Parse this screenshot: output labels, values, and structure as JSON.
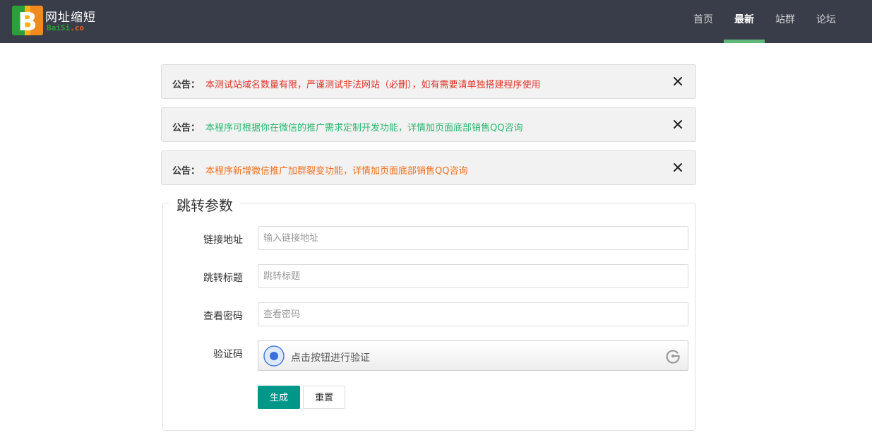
{
  "header": {
    "logo_letter": "B",
    "site_title": "网址缩短",
    "site_sub_green": "BaiSi",
    "site_sub_orange": ".co",
    "nav": [
      {
        "label": "首页",
        "active": false
      },
      {
        "label": "最新",
        "active": true
      },
      {
        "label": "站群",
        "active": false
      },
      {
        "label": "论坛",
        "active": false
      }
    ]
  },
  "notices": [
    {
      "label": "公告：",
      "text": "本测试站域名数量有限，严谨测试非法网站（必删），如有需要请单独搭建程序使用",
      "color": "#e0352b"
    },
    {
      "label": "公告：",
      "text": "本程序可根据你在微信的推广需求定制开发功能，详情加页面底部销售QQ咨询",
      "color": "#2ab870"
    },
    {
      "label": "公告：",
      "text": "本程序新增微信推广加群裂变功能，详情加页面底部销售QQ咨询",
      "color": "#f0701c"
    }
  ],
  "form": {
    "legend": "跳转参数",
    "link_label": "链接地址",
    "link_placeholder": "输入链接地址",
    "title_label": "跳转标题",
    "title_placeholder": "跳转标题",
    "password_label": "查看密码",
    "password_placeholder": "查看密码",
    "captcha_label": "验证码",
    "captcha_text": "点击按钮进行验证",
    "submit_label": "生成",
    "reset_label": "重置"
  },
  "colors": {
    "header_bg": "#393d49",
    "nav_active_underline": "#5fb878",
    "primary_button": "#009688"
  },
  "icons": [
    "logo-b-icon",
    "close-icon",
    "captcha-dot-icon",
    "captcha-brand-icon"
  ]
}
